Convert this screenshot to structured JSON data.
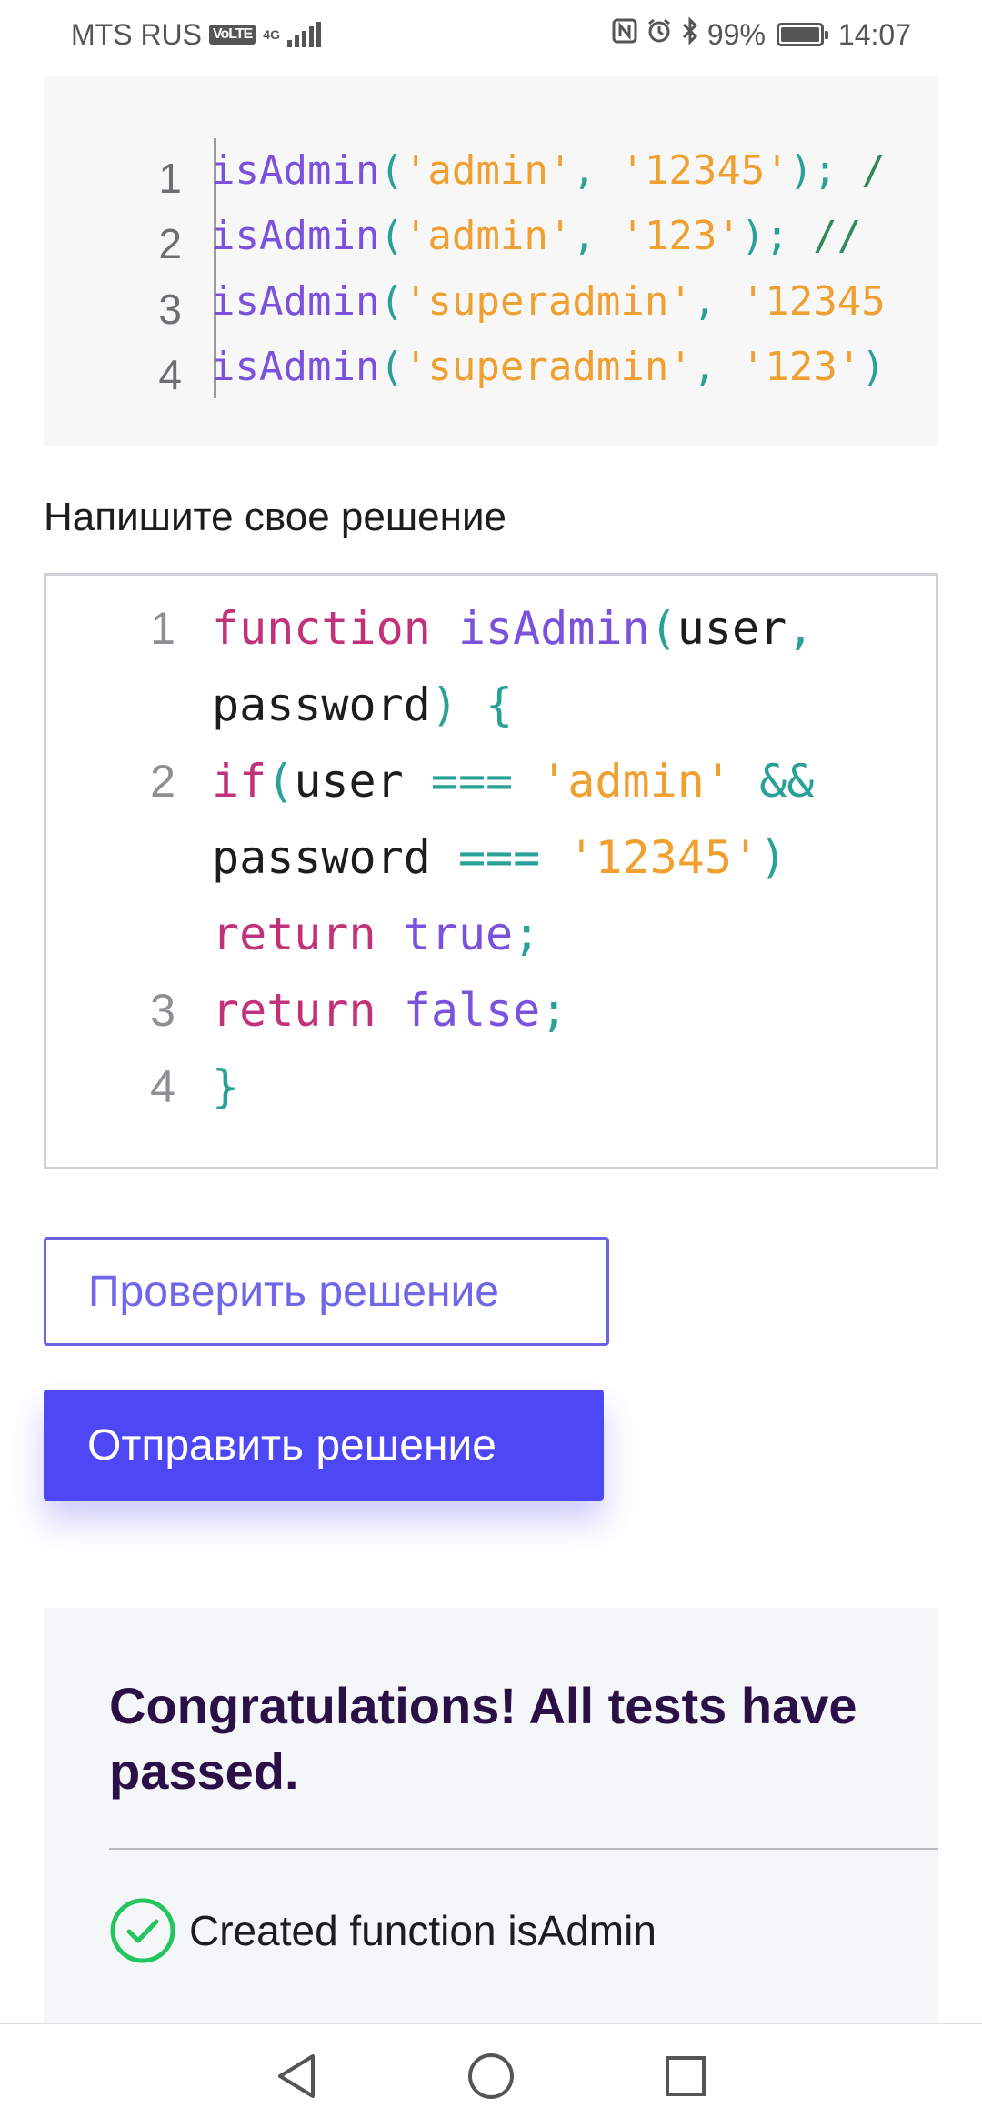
{
  "status_bar": {
    "carrier": "MTS RUS",
    "volte": "VoLTE",
    "network": "4G",
    "battery": "99%",
    "time": "14:07"
  },
  "example": {
    "line_numbers": [
      "1",
      "2",
      "3",
      "4"
    ],
    "lines": [
      [
        {
          "t": "isAdmin",
          "c": "fn"
        },
        {
          "t": "(",
          "c": "pn"
        },
        {
          "t": "'admin'",
          "c": "str"
        },
        {
          "t": ", ",
          "c": "pn"
        },
        {
          "t": "'12345'",
          "c": "str"
        },
        {
          "t": "); ",
          "c": "pn"
        },
        {
          "t": "/",
          "c": "cm"
        }
      ],
      [
        {
          "t": "isAdmin",
          "c": "fn"
        },
        {
          "t": "(",
          "c": "pn"
        },
        {
          "t": "'admin'",
          "c": "str"
        },
        {
          "t": ", ",
          "c": "pn"
        },
        {
          "t": "'123'",
          "c": "str"
        },
        {
          "t": "); ",
          "c": "pn"
        },
        {
          "t": "//",
          "c": "cm"
        }
      ],
      [
        {
          "t": "isAdmin",
          "c": "fn"
        },
        {
          "t": "(",
          "c": "pn"
        },
        {
          "t": "'superadmin'",
          "c": "str"
        },
        {
          "t": ", ",
          "c": "pn"
        },
        {
          "t": "'12345",
          "c": "str"
        }
      ],
      [
        {
          "t": "isAdmin",
          "c": "fn"
        },
        {
          "t": "(",
          "c": "pn"
        },
        {
          "t": "'superadmin'",
          "c": "str"
        },
        {
          "t": ", ",
          "c": "pn"
        },
        {
          "t": "'123'",
          "c": "str"
        },
        {
          "t": ")",
          "c": "pn"
        }
      ]
    ]
  },
  "prompt_label": "Напишите свое решение",
  "editor": {
    "line_numbers": [
      "1",
      "2",
      "3",
      "4"
    ],
    "visual_lines": [
      [
        {
          "t": "function",
          "c": "kw"
        },
        {
          "t": " ",
          "c": "ident"
        },
        {
          "t": "isAdmin",
          "c": "fn"
        },
        {
          "t": "(",
          "c": "pn"
        },
        {
          "t": "user",
          "c": "ident"
        },
        {
          "t": ",",
          "c": "pn"
        }
      ],
      [
        {
          "t": "password",
          "c": "ident"
        },
        {
          "t": ")",
          "c": "pn"
        },
        {
          "t": " ",
          "c": "ident"
        },
        {
          "t": "{",
          "c": "pn"
        }
      ],
      [
        {
          "t": "if",
          "c": "kw"
        },
        {
          "t": "(",
          "c": "pn"
        },
        {
          "t": "user",
          "c": "ident"
        },
        {
          "t": " ",
          "c": "ident"
        },
        {
          "t": "===",
          "c": "pn"
        },
        {
          "t": " ",
          "c": "ident"
        },
        {
          "t": "'admin'",
          "c": "str"
        },
        {
          "t": " ",
          "c": "ident"
        },
        {
          "t": "&&",
          "c": "pn"
        }
      ],
      [
        {
          "t": "password",
          "c": "ident"
        },
        {
          "t": " ",
          "c": "ident"
        },
        {
          "t": "===",
          "c": "pn"
        },
        {
          "t": " ",
          "c": "ident"
        },
        {
          "t": "'12345'",
          "c": "str"
        },
        {
          "t": ")",
          "c": "pn"
        }
      ],
      [
        {
          "t": "return",
          "c": "kw"
        },
        {
          "t": " ",
          "c": "ident"
        },
        {
          "t": "true",
          "c": "bool"
        },
        {
          "t": ";",
          "c": "pn"
        }
      ],
      [
        {
          "t": "return",
          "c": "kw"
        },
        {
          "t": " ",
          "c": "ident"
        },
        {
          "t": "false",
          "c": "bool"
        },
        {
          "t": ";",
          "c": "pn"
        }
      ],
      [
        {
          "t": "}",
          "c": "pn"
        }
      ]
    ]
  },
  "buttons": {
    "check": "Проверить решение",
    "submit": "Отправить решение"
  },
  "result": {
    "title": "Congratulations! All tests have passed.",
    "tests": [
      "Created function isAdmin"
    ]
  },
  "colors": {
    "accent": "#4d47f5",
    "success": "#22c55e",
    "title": "#2b0f47"
  }
}
